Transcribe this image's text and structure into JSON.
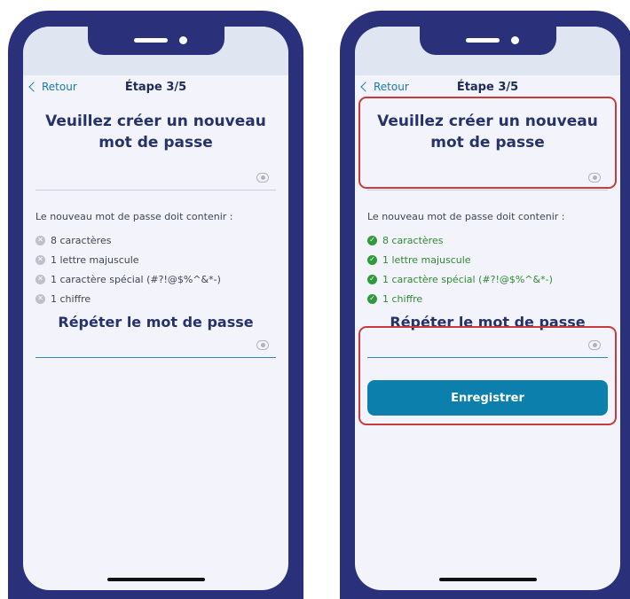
{
  "screens": [
    {
      "nav": {
        "back_label": "Retour",
        "step_label": "Étape 3/5"
      },
      "title": "Veuillez créer un nouveau mot de passe",
      "requirements_title": "Le nouveau mot de passe doit contenir :",
      "requirements": [
        {
          "text": "8 caractères",
          "status": "unmet"
        },
        {
          "text": "1 lettre majuscule",
          "status": "unmet"
        },
        {
          "text": "1 caractère spécial (#?!@$%^&*-)",
          "status": "unmet"
        },
        {
          "text": "1 chiffre",
          "status": "unmet"
        }
      ],
      "repeat_title": "Répéter le mot de passe"
    },
    {
      "nav": {
        "back_label": "Retour",
        "step_label": "Étape 3/5"
      },
      "title": "Veuillez créer un nouveau mot de passe",
      "requirements_title": "Le nouveau mot de passe doit contenir :",
      "requirements": [
        {
          "text": "8 caractères",
          "status": "met"
        },
        {
          "text": "1 lettre majuscule",
          "status": "met"
        },
        {
          "text": "1 caractère spécial (#?!@$%^&*-)",
          "status": "met"
        },
        {
          "text": "1 chiffre",
          "status": "met"
        }
      ],
      "repeat_title": "Répéter le mot de passe",
      "save_label": "Enregistrer"
    }
  ],
  "icons": {
    "back": "chevron-left-icon",
    "visibility": "eye-icon",
    "unmet": "x-circle-icon",
    "met": "check-circle-icon"
  },
  "colors": {
    "frame": "#2b307a",
    "accent": "#0c7fac",
    "title": "#26336a",
    "met": "#2f9a3a",
    "unmet": "#bcc0c9",
    "highlight": "#c73b3b"
  }
}
